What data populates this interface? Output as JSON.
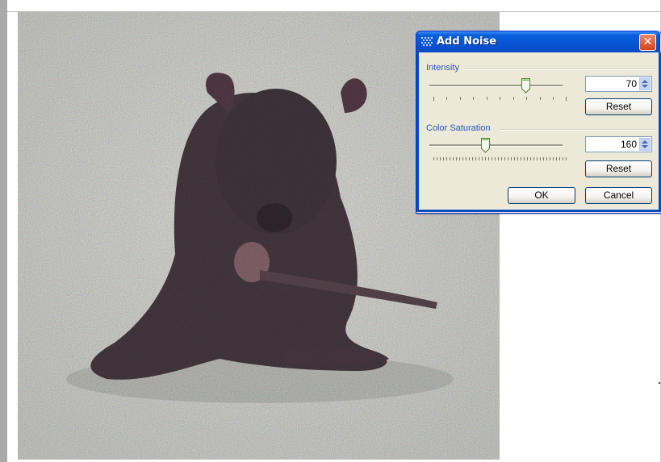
{
  "dialog": {
    "title": "Add Noise",
    "close_symbol": "✕",
    "intensity": {
      "label": "Intensity",
      "value": "70",
      "reset_label": "Reset"
    },
    "color_saturation": {
      "label": "Color Saturation",
      "value": "160",
      "reset_label": "Reset"
    },
    "ok_label": "OK",
    "cancel_label": "Cancel"
  },
  "icons": {
    "title": "noise-effect-icon",
    "close": "close-icon",
    "spin": "spin-arrows-icon"
  },
  "colors": {
    "title_bar": "#0753d4",
    "dialog_bg": "#ece9d8",
    "label_blue": "#2353c4",
    "close_red": "#d4431c"
  }
}
